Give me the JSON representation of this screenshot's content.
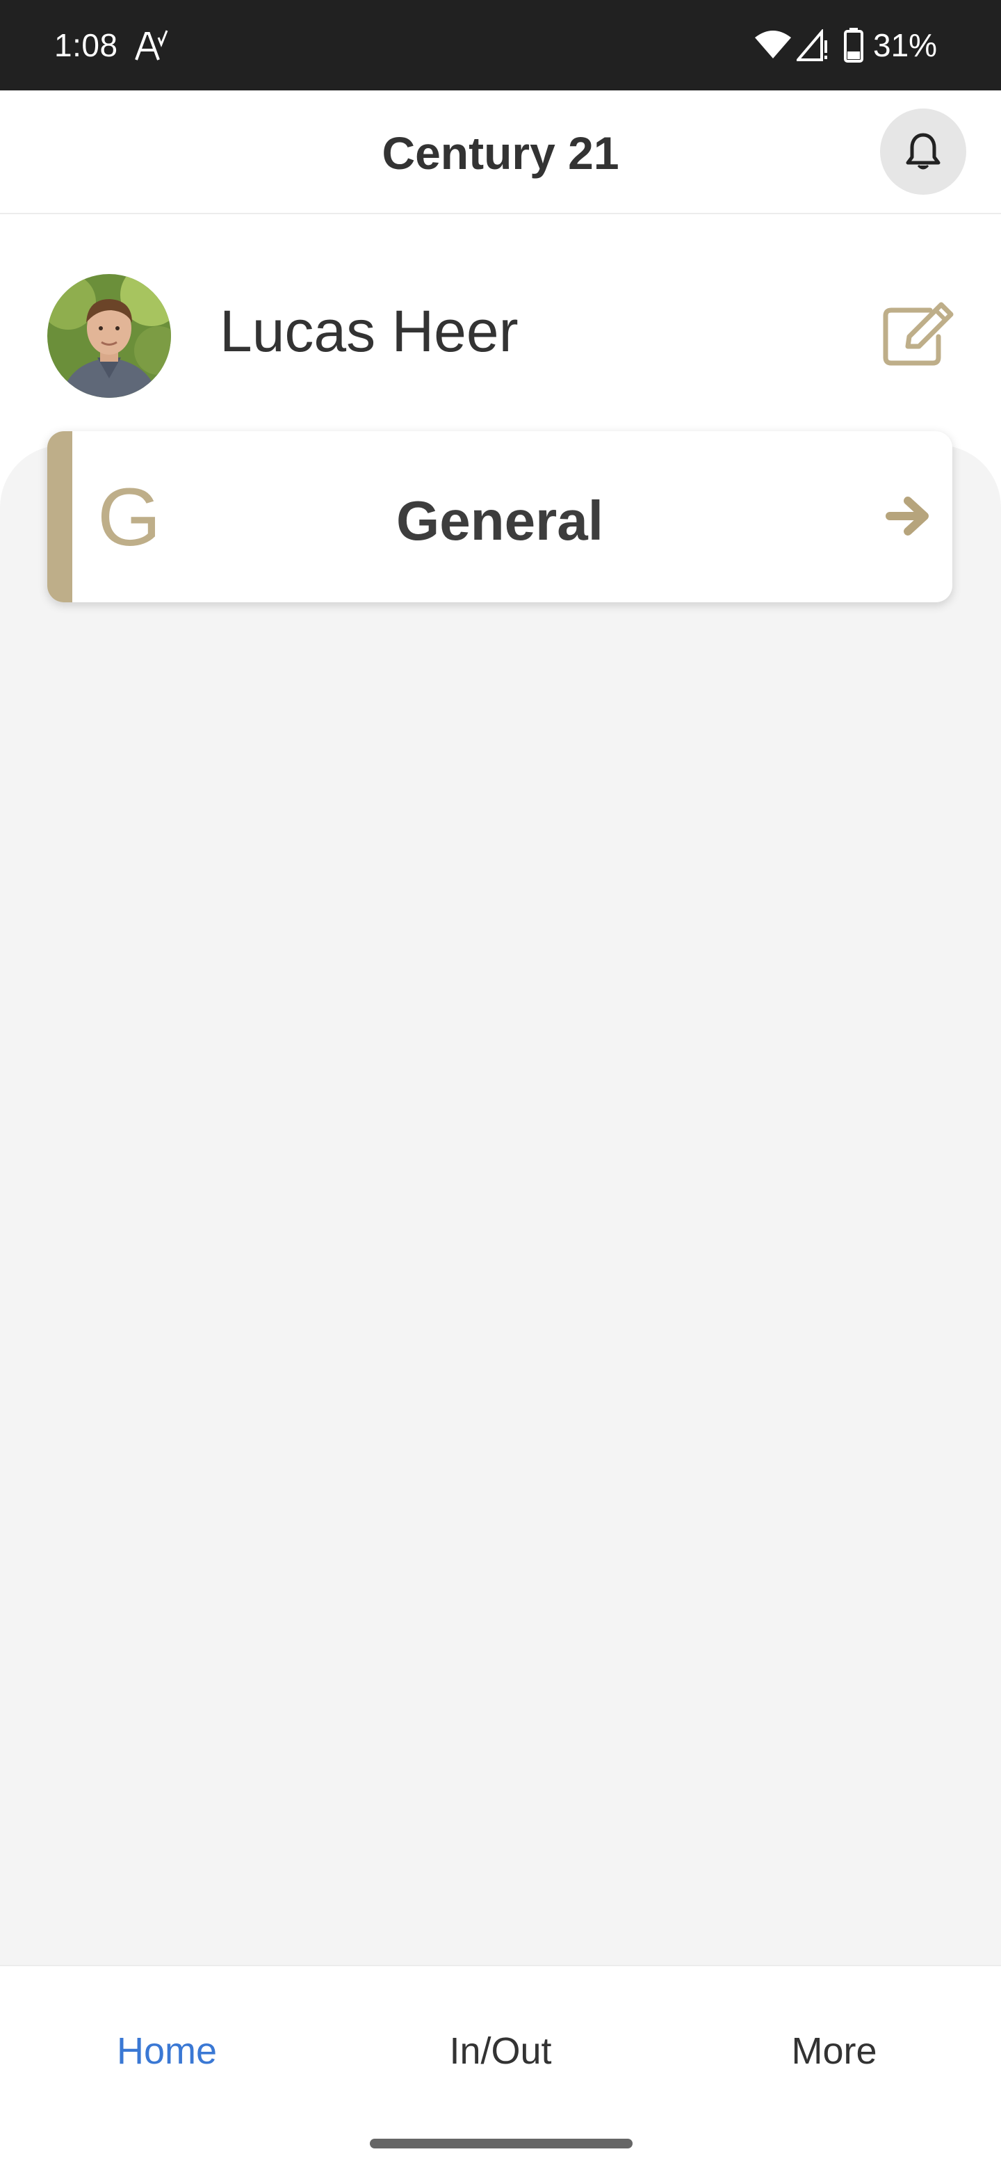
{
  "status_bar": {
    "time": "1:08",
    "battery": "31%",
    "icons": [
      "a-accessibility-icon",
      "wifi-icon",
      "signal-icon",
      "battery-icon"
    ]
  },
  "header": {
    "title": "Century 21",
    "bell_icon": "bell-icon"
  },
  "profile": {
    "name": "Lucas Heer",
    "edit_icon": "edit-icon"
  },
  "groups": [
    {
      "initial": "G",
      "label": "General",
      "arrow_icon": "arrow-right-icon"
    }
  ],
  "bottom_nav": {
    "tabs": [
      {
        "label": "Home",
        "active": true
      },
      {
        "label": "In/Out",
        "active": false
      },
      {
        "label": "More",
        "active": false
      }
    ]
  },
  "colors": {
    "accent_gold": "#beae89",
    "active_tab_blue": "#3a78d4",
    "status_bar_bg": "#212121",
    "content_bg": "#f4f4f4"
  }
}
